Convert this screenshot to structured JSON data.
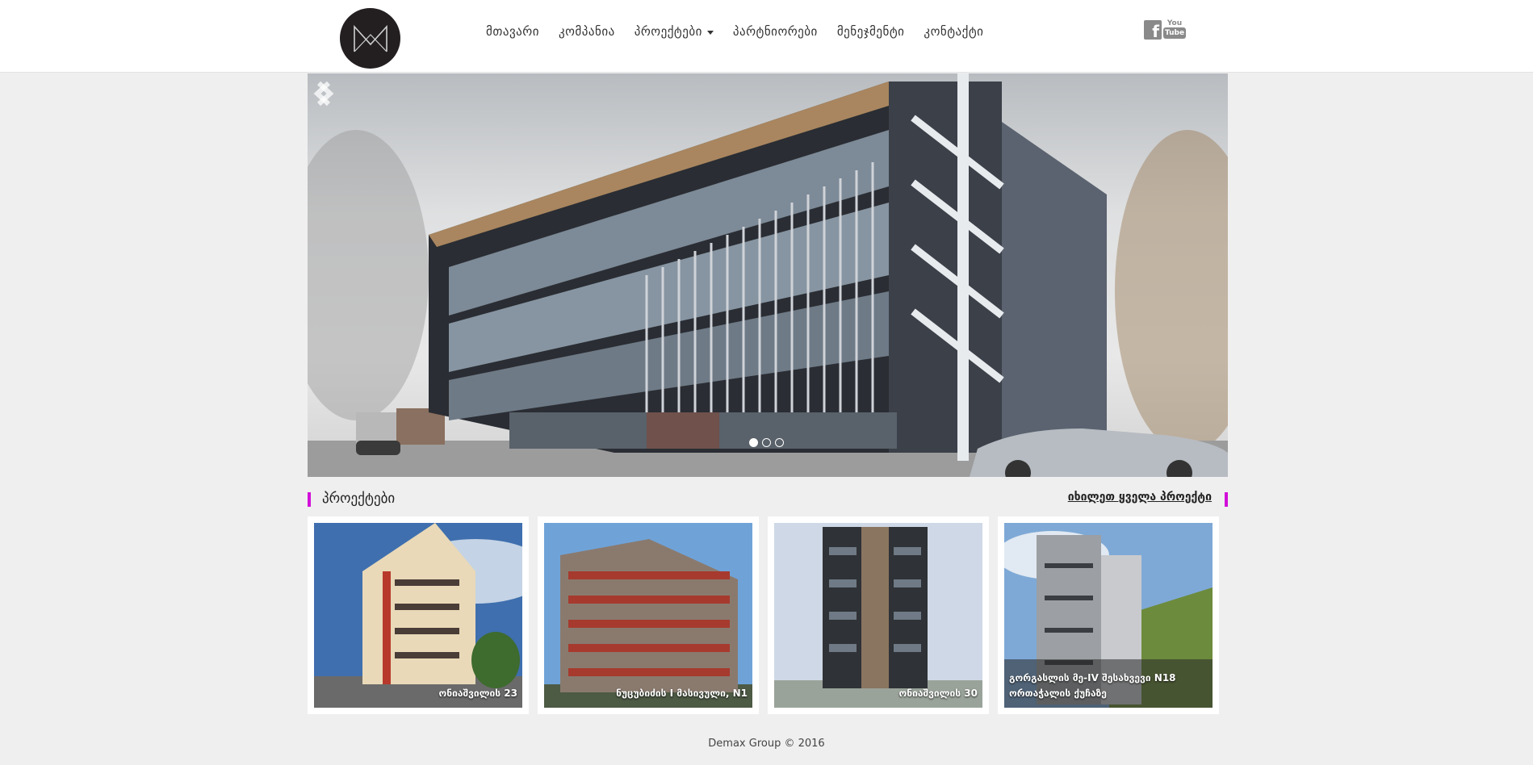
{
  "header": {
    "nav": [
      {
        "label": "მთავარი"
      },
      {
        "label": "კომპანია"
      },
      {
        "label": "პროექტები"
      },
      {
        "label": "პარტნიორები"
      },
      {
        "label": "მენეჯმენტი"
      },
      {
        "label": "კონტაქტი"
      }
    ],
    "social": {
      "facebook": "f",
      "youtube_top": "You",
      "youtube_bottom": "Tube"
    }
  },
  "projects": {
    "title": "პროექტები",
    "see_all": "იხილეთ ყველა პროექტი",
    "items": [
      {
        "caption": "ონიაშვილის 23"
      },
      {
        "caption": "ნუცუბიძის I მასივული, N1"
      },
      {
        "caption": "ონიაშვილის 30"
      },
      {
        "caption": "გორგასლის მე-IV შესახვევი N18 ორთაჭალის ქუჩაზე"
      }
    ]
  },
  "slider": {
    "slide_count": 3,
    "active": 1
  },
  "footer": {
    "text": "Demax Group © 2016"
  },
  "colors": {
    "accent": "#d10fd8",
    "logo_bg": "#231f20"
  }
}
